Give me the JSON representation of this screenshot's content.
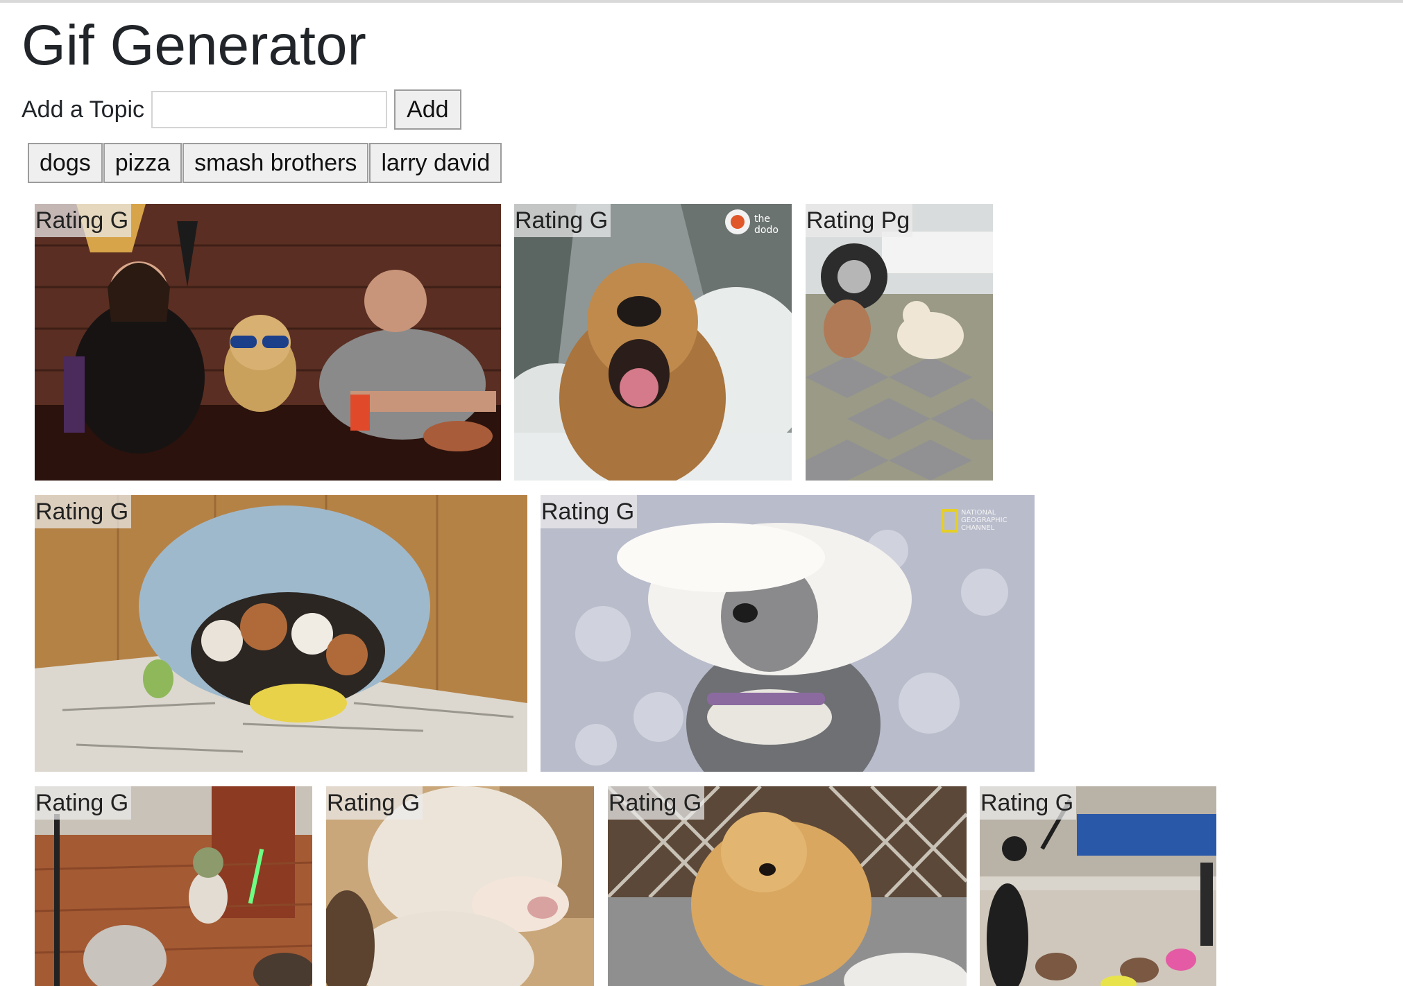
{
  "header": {
    "title": "Gif Generator"
  },
  "add_topic": {
    "label": "Add a Topic",
    "value": "",
    "placeholder": "",
    "button_label": "Add"
  },
  "topics": [
    "dogs",
    "pizza",
    "smash brothers",
    "larry david"
  ],
  "gifs": [
    {
      "rating": "Rating G",
      "subject": "people-and-dog-in-sunglasses-at-bar"
    },
    {
      "rating": "Rating G",
      "subject": "golden-retriever-in-snow",
      "logo": "the dodo"
    },
    {
      "rating": "Rating Pg",
      "subject": "two-small-dogs-by-car"
    },
    {
      "rating": "Rating G",
      "subject": "puppies-in-blue-dog-bed"
    },
    {
      "rating": "Rating G",
      "subject": "windblown-crested-dog",
      "logo": "NATIONAL GEOGRAPHIC CHANNEL"
    },
    {
      "rating": "Rating G",
      "subject": "dog-in-yoda-costume"
    },
    {
      "rating": "Rating G",
      "subject": "white-labrador"
    },
    {
      "rating": "Rating G",
      "subject": "golden-retriever-by-lattice"
    },
    {
      "rating": "Rating G",
      "subject": "people-jumping-rope-with-dogs"
    }
  ]
}
